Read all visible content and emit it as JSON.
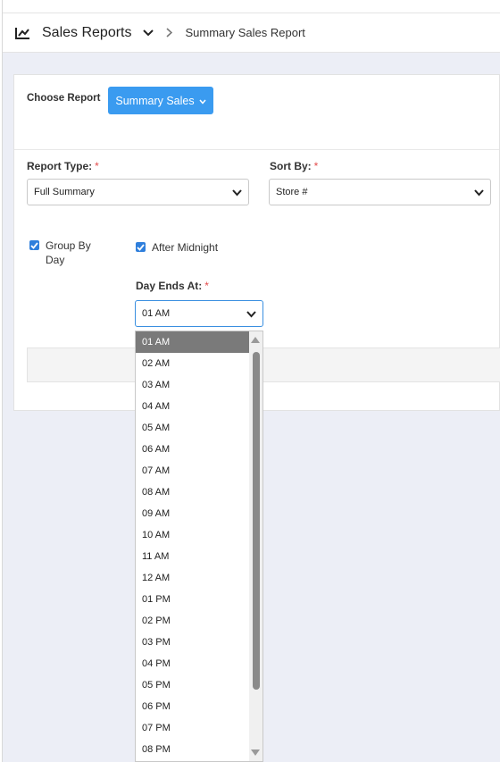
{
  "header": {
    "title": "Sales Reports",
    "breadcrumb": "Summary Sales Report"
  },
  "report": {
    "choose_label": "Choose Report",
    "button_label": "Summary Sales"
  },
  "report_type": {
    "label": "Report Type:",
    "required": "*",
    "value": "Full Summary"
  },
  "sort_by": {
    "label": "Sort By:",
    "required": "*",
    "value": "Store #"
  },
  "group_by_day": {
    "label_line1": "Group By",
    "label_line2": "Day",
    "checked": true
  },
  "after_midnight": {
    "label": "After Midnight",
    "checked": true
  },
  "day_ends_at": {
    "label": "Day Ends At:",
    "required": "*",
    "value": "01 AM"
  },
  "dropdown": {
    "options": [
      "01 AM",
      "02 AM",
      "03 AM",
      "04 AM",
      "05 AM",
      "06 AM",
      "07 AM",
      "08 AM",
      "09 AM",
      "10 AM",
      "11 AM",
      "12 AM",
      "01 PM",
      "02 PM",
      "03 PM",
      "04 PM",
      "05 PM",
      "06 PM",
      "07 PM",
      "08 PM"
    ],
    "selected_index": 0
  },
  "colors": {
    "accent": "#3a9bf0",
    "checkbox": "#2f7fdc",
    "required": "#e34b4b",
    "selected_option": "#7a7a7a",
    "page_bg": "#eceef6"
  }
}
